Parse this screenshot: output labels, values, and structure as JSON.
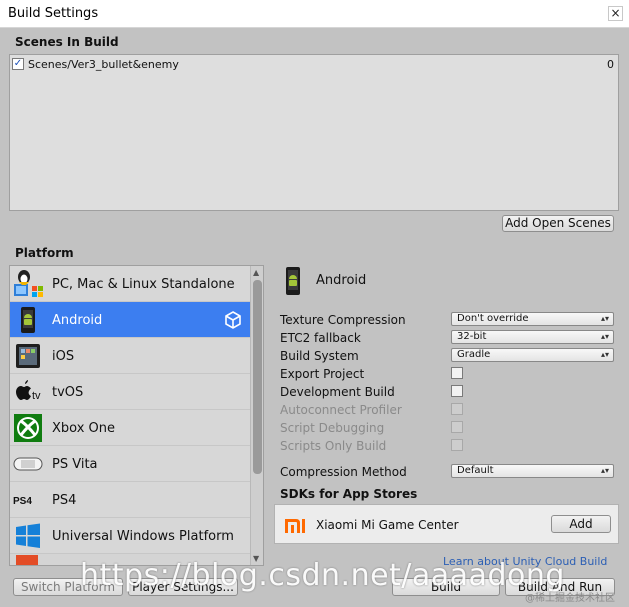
{
  "window": {
    "title": "Build Settings",
    "close_glyph": "×"
  },
  "scenes": {
    "heading": "Scenes In Build",
    "items": [
      {
        "name": "Scenes/Ver3_bullet&enemy",
        "index": "0",
        "checked": true
      }
    ],
    "add_open_scenes": "Add Open Scenes"
  },
  "platform": {
    "heading": "Platform",
    "items": [
      {
        "label": "PC, Mac & Linux Standalone",
        "icon": "pc-mac-linux-icon"
      },
      {
        "label": "Android",
        "icon": "android-icon",
        "selected": true,
        "active_badge": "unity-logo-icon"
      },
      {
        "label": "iOS",
        "icon": "ios-icon"
      },
      {
        "label": "tvOS",
        "icon": "tvos-icon"
      },
      {
        "label": "Xbox One",
        "icon": "xbox-icon"
      },
      {
        "label": "PS Vita",
        "icon": "ps-vita-icon"
      },
      {
        "label": "PS4",
        "icon": "ps4-icon"
      },
      {
        "label": "Universal Windows Platform",
        "icon": "windows-icon"
      }
    ]
  },
  "settings": {
    "platform_title": "Android",
    "texture_compression": {
      "label": "Texture Compression",
      "value": "Don't override"
    },
    "etc2_fallback": {
      "label": "ETC2 fallback",
      "value": "32-bit"
    },
    "build_system": {
      "label": "Build System",
      "value": "Gradle"
    },
    "export_project": {
      "label": "Export Project",
      "checked": false
    },
    "development_build": {
      "label": "Development Build",
      "checked": false
    },
    "autoconnect_profiler": {
      "label": "Autoconnect Profiler",
      "checked": false
    },
    "script_debugging": {
      "label": "Script Debugging",
      "checked": false
    },
    "scripts_only_build": {
      "label": "Scripts Only Build",
      "checked": false
    },
    "compression_method": {
      "label": "Compression Method",
      "value": "Default"
    }
  },
  "sdks": {
    "heading": "SDKs for App Stores",
    "items": [
      {
        "name": "Xiaomi Mi Game Center",
        "button": "Add"
      }
    ],
    "learn_link": "Learn about Unity Cloud Build"
  },
  "footer": {
    "switch_platform": "Switch Platform",
    "player_settings": "Player Settings...",
    "build": "Build",
    "build_and_run": "Build And Run"
  },
  "watermark": {
    "text": "https://blog.csdn.net/aaaadong",
    "sub": "@稀土掘金技术社区"
  },
  "colors": {
    "selected": "#3c7ef0",
    "panel": "#c2c2c2",
    "link": "#2c5fb4"
  }
}
